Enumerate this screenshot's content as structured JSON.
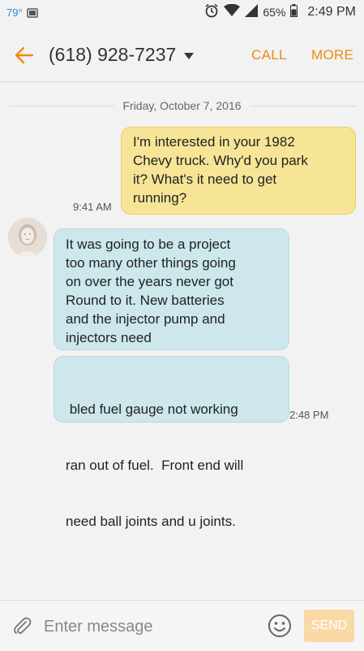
{
  "status_bar": {
    "temperature": "79°",
    "battery": "65%",
    "time": "2:49 PM"
  },
  "header": {
    "contact": "(618) 928-7237",
    "call_label": "CALL",
    "more_label": "MORE"
  },
  "conversation": {
    "date": "Friday, October 7, 2016",
    "messages": [
      {
        "direction": "outgoing",
        "lines": [
          "I'm interested in your 1982",
          "Chevy truck.  Why'd you park",
          "it?  What's it need to get",
          "running?"
        ],
        "time": "9:41 AM"
      },
      {
        "direction": "incoming",
        "lines": [
          "It was going to be a project",
          "too many other things going",
          "on over the years never got",
          "Round to it.  New batteries",
          "and the injector pump and",
          "injectors need"
        ]
      },
      {
        "direction": "incoming",
        "lines": [
          " bled fuel gauge not working",
          "ran out of fuel.  Front end will",
          "need ball joints and u joints."
        ],
        "time": "2:48 PM"
      }
    ]
  },
  "composer": {
    "placeholder": "Enter message",
    "send_label": "SEND"
  },
  "colors": {
    "accent": "#f08a14",
    "outgoing_bubble": "#f6e597",
    "incoming_bubble": "#cde7ec"
  },
  "icons": [
    "gallery-icon",
    "alarm-icon",
    "wifi-icon",
    "signal-icon",
    "battery-icon",
    "back-arrow-icon",
    "dropdown-caret-icon",
    "contact-avatar",
    "attachment-icon",
    "emoji-icon"
  ]
}
